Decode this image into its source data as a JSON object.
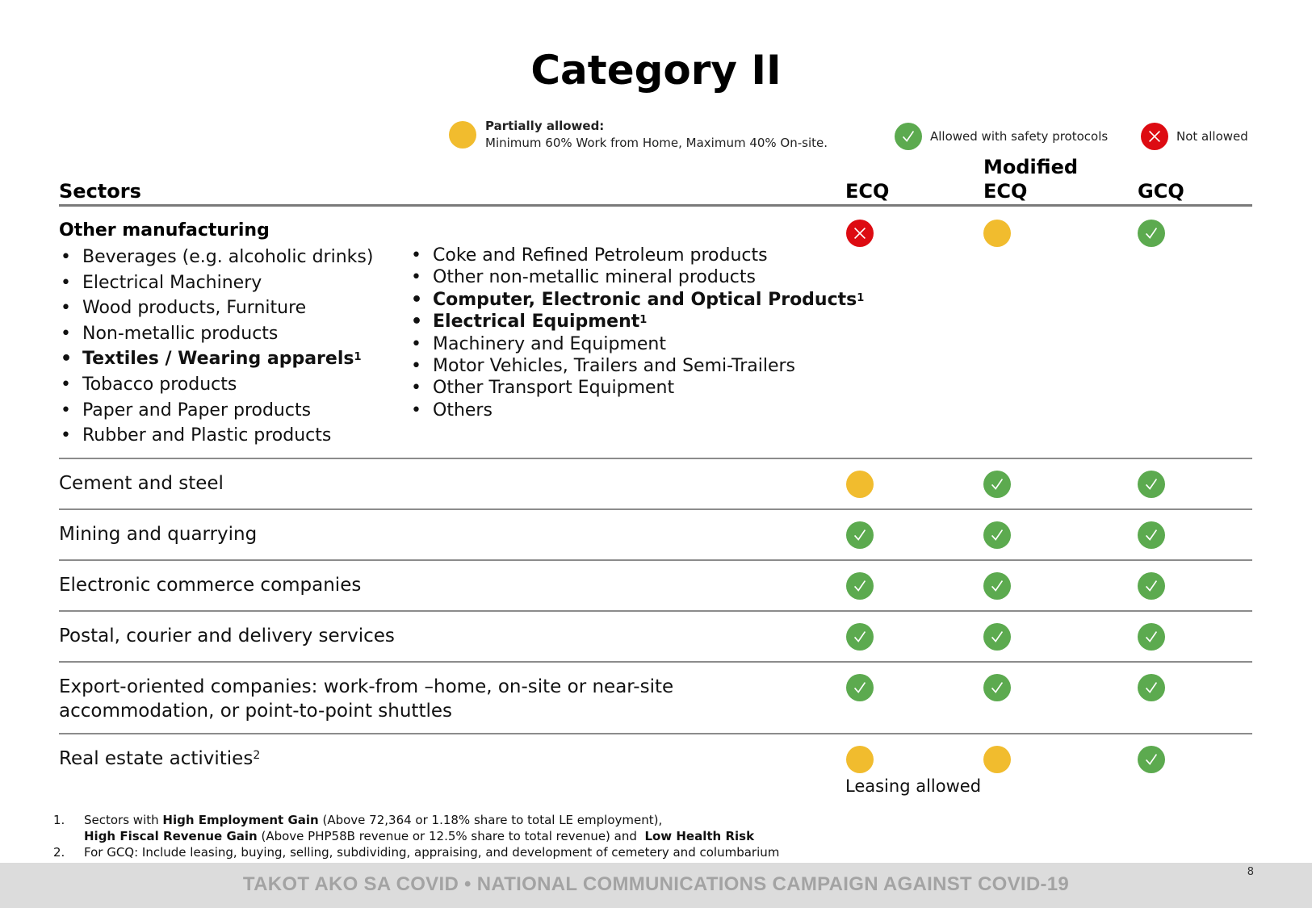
{
  "title": "Category II",
  "legend": {
    "partial": {
      "label": "Partially allowed:",
      "desc": "Minimum 60% Work from Home,  Maximum 40% On-site.",
      "color": "#f1bc2e"
    },
    "allowed": {
      "label": "Allowed with safety protocols",
      "color": "#5caa4f"
    },
    "not_allowed": {
      "label": "Not allowed",
      "color": "#dd0b12"
    }
  },
  "columns": {
    "sectors": "Sectors",
    "ecq": "ECQ",
    "mecq_line1": "Modified",
    "mecq_line2": "ECQ",
    "gcq": "GCQ"
  },
  "groups": {
    "other_manufacturing": {
      "title": "Other manufacturing",
      "col1": [
        {
          "text": "Beverages (e.g. alcoholic drinks)",
          "bold": false,
          "sup": ""
        },
        {
          "text": "Electrical Machinery",
          "bold": false,
          "sup": ""
        },
        {
          "text": "Wood products, Furniture",
          "bold": false,
          "sup": ""
        },
        {
          "text": "Non-metallic products",
          "bold": false,
          "sup": ""
        },
        {
          "text": "Textiles / Wearing apparels",
          "bold": true,
          "sup": "1"
        },
        {
          "text": "Tobacco products",
          "bold": false,
          "sup": ""
        },
        {
          "text": "Paper and Paper products",
          "bold": false,
          "sup": ""
        },
        {
          "text": "Rubber and Plastic products",
          "bold": false,
          "sup": ""
        }
      ],
      "col2": [
        {
          "text": "Coke and Refined Petroleum products",
          "bold": false,
          "sup": ""
        },
        {
          "text": "Other non-metallic mineral products",
          "bold": false,
          "sup": ""
        },
        {
          "text": "Computer, Electronic and Optical Products",
          "bold": true,
          "sup": "1"
        },
        {
          "text": "Electrical Equipment",
          "bold": true,
          "sup": "1"
        },
        {
          "text": "Machinery and Equipment",
          "bold": false,
          "sup": ""
        },
        {
          "text": "Motor Vehicles, Trailers and Semi-Trailers",
          "bold": false,
          "sup": ""
        },
        {
          "text": "Other Transport Equipment",
          "bold": false,
          "sup": ""
        },
        {
          "text": "Others",
          "bold": false,
          "sup": ""
        }
      ],
      "status": {
        "ecq": "not_allowed",
        "mecq": "partial",
        "gcq": "allowed"
      }
    }
  },
  "rows": [
    {
      "label": "Cement and steel",
      "sup": "",
      "status": {
        "ecq": "partial",
        "mecq": "allowed",
        "gcq": "allowed"
      }
    },
    {
      "label": "Mining and quarrying",
      "sup": "",
      "status": {
        "ecq": "allowed",
        "mecq": "allowed",
        "gcq": "allowed"
      }
    },
    {
      "label": "Electronic commerce companies",
      "sup": "",
      "status": {
        "ecq": "allowed",
        "mecq": "allowed",
        "gcq": "allowed"
      }
    },
    {
      "label": "Postal, courier and delivery services",
      "sup": "",
      "status": {
        "ecq": "allowed",
        "mecq": "allowed",
        "gcq": "allowed"
      }
    },
    {
      "label": "Export-oriented companies: work-from –home, on-site or near-site accommodation, or point-to-point shuttles",
      "sup": "",
      "status": {
        "ecq": "allowed",
        "mecq": "allowed",
        "gcq": "allowed"
      }
    },
    {
      "label": "Real estate activities",
      "sup": "2",
      "status": {
        "ecq": "partial",
        "mecq": "partial",
        "gcq": "allowed"
      },
      "note": "Leasing allowed"
    }
  ],
  "footnotes": {
    "fn1": {
      "num": "1.",
      "p1": "Sectors with ",
      "b1": "High Employment Gain",
      "p2": " (Above 72,364 or 1.18% share to total LE employment),",
      "b2": "High Fiscal Revenue Gain",
      "p3": " (Above PHP58B revenue or 12.5% share to total revenue) and  ",
      "b3": "Low Health Risk"
    },
    "fn2": {
      "num": "2.",
      "text": "For GCQ: Include leasing, buying, selling, subdividing, appraising, and development of cemetery and columbarium"
    }
  },
  "footer": {
    "campaign": "TAKOT AKO SA COVID • NATIONAL COMMUNICATIONS CAMPAIGN AGAINST COVID-19",
    "page_number": "8"
  }
}
